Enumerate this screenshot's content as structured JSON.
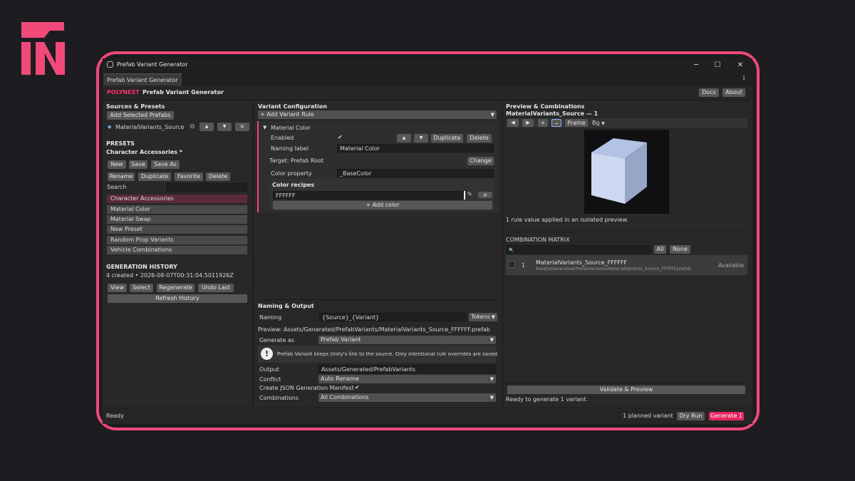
{
  "window": {
    "title": "Prefab Variant Generator",
    "tab": "Prefab Variant Generator"
  },
  "header": {
    "brand": "POLYNEST",
    "title": "Prefab Variant Generator",
    "docs": "Docs",
    "about": "About"
  },
  "sources": {
    "heading": "Sources & Presets",
    "add_selected": "Add Selected Prefabs",
    "item": "MaterialVariants_Source",
    "btn_up": "▲",
    "btn_down": "▼",
    "btn_remove": "×"
  },
  "presets": {
    "heading": "PRESETS",
    "current": "Character Accessories *",
    "buttons": [
      "New",
      "Save",
      "Save As",
      "Rename",
      "Duplicate",
      "Favorite",
      "Delete"
    ],
    "search_label": "Search",
    "items": [
      "Character Accessories",
      "Material Color",
      "Material Swap",
      "New Preset",
      "Random Prop Variants",
      "Vehicle Combinations"
    ]
  },
  "history": {
    "heading": "GENERATION HISTORY",
    "info": "4 created • 2026-08-07T00:31:04.5011926Z",
    "buttons": [
      "View",
      "Select",
      "Regenerate",
      "Undo Last"
    ],
    "refresh": "Refresh History"
  },
  "variant_config": {
    "heading": "Variant Configuration",
    "add_rule": "+ Add Variant Rule",
    "rule": {
      "title": "Material Color",
      "enabled_label": "Enabled",
      "enabled_check": "✔",
      "up": "▲",
      "down": "▼",
      "duplicate": "Duplicate",
      "delete": "Delete",
      "naming_label": "Naming label",
      "naming_value": "Material Color",
      "target": "Target: Prefab Root",
      "change": "Change",
      "color_property_label": "Color property",
      "color_property_value": "_BaseColor",
      "recipes_heading": "Color recipes",
      "recipe_value": "FFFFFF",
      "recipe_remove": "×",
      "add_color": "+ Add color"
    }
  },
  "naming_output": {
    "heading": "Naming & Output",
    "naming_label": "Naming",
    "naming_value": "{Source}_{Variant}",
    "tokens": "Tokens",
    "preview": "Preview: Assets/Generated/PrefabVariants/MaterialVariants_Source_FFFFFF.prefab",
    "generate_as_label": "Generate as",
    "generate_as_value": "Prefab Variant",
    "info_text": "Prefab Variant keeps Unity's link to the source. Only intentional rule overrides are saved.",
    "output_label": "Output",
    "output_value": "Assets/Generated/PrefabVariants",
    "conflict_label": "Conflict",
    "conflict_value": "Auto Rename",
    "manifest_label": "Create JSON Generation Manifest",
    "manifest_check": "✔",
    "combinations_label": "Combinations",
    "combinations_value": "All Combinations"
  },
  "preview": {
    "heading": "Preview & Combinations",
    "subheading": "MaterialVariants_Source — 1",
    "prev": "◀",
    "next": "▶",
    "plus": "+",
    "minus": "−",
    "frame": "Frame",
    "bg": "Bg",
    "note": "1 rule value applied in an isolated preview.",
    "cube_colors": {
      "top": "#b3c3e4",
      "front": "#cdd9f0",
      "side": "#95a6c7",
      "bg": "#101012"
    }
  },
  "matrix": {
    "heading": "COMBINATION MATRIX",
    "all": "All",
    "none": "None",
    "row": {
      "index": "1",
      "name": "MaterialVariants_Source_FFFFFF",
      "path": "Assets/Generated/PrefabVariants/MaterialVariants_Source_FFFFFF.prefab",
      "status": "Available"
    }
  },
  "validate": {
    "button": "Validate & Preview",
    "status": "Ready to generate 1 variant."
  },
  "footer": {
    "status": "Ready",
    "planned": "1 planned variant",
    "dry_run": "Dry Run",
    "generate": "Generate 1"
  },
  "colors": {
    "accent": "#f0497a",
    "brand": "#ff2f6a",
    "generate_btn": "#e8255f"
  }
}
